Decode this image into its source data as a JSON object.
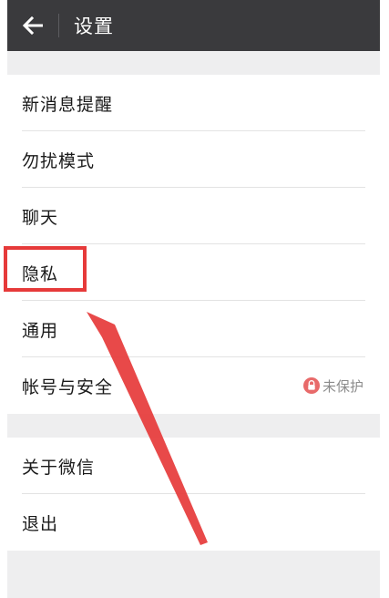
{
  "header": {
    "title": "设置"
  },
  "settings": {
    "group1": [
      {
        "label": "新消息提醒"
      },
      {
        "label": "勿扰模式"
      },
      {
        "label": "聊天"
      },
      {
        "label": "隐私"
      },
      {
        "label": "通用"
      },
      {
        "label": "帐号与安全"
      }
    ],
    "account_status": "未保护",
    "group2": [
      {
        "label": "关于微信"
      },
      {
        "label": "退出"
      }
    ]
  },
  "icons": {
    "back": "arrow-left-icon",
    "status": "lock-icon"
  },
  "colors": {
    "titlebar": "#3a3a3d",
    "background": "#eeeeef",
    "annotation": "#e63a3a",
    "status_icon": "#e86a6a"
  }
}
